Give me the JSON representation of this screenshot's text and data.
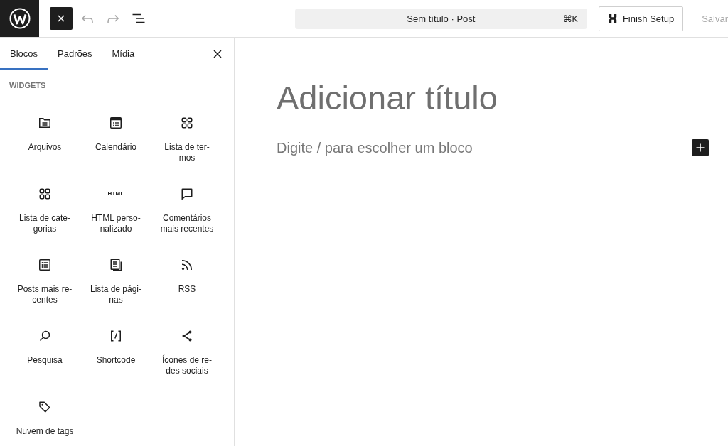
{
  "top_bar": {
    "undo": {
      "disabled": true
    },
    "redo": {
      "disabled": true
    },
    "command_bar": {
      "title": "Sem título · Post",
      "shortcut": "⌘K"
    },
    "finish_setup_button": {
      "label": "Finish Setup"
    },
    "save_button": {
      "label": "Salvar",
      "disabled": true
    }
  },
  "inserter": {
    "tabs": [
      {
        "label": "Blocos",
        "selected": true
      },
      {
        "label": "Padrões",
        "selected": false
      },
      {
        "label": "Mídia",
        "selected": false
      }
    ],
    "section_heading": "WIDGETS",
    "blocks": [
      {
        "label": "Arquivos",
        "kind": "archives"
      },
      {
        "label": "Calendário",
        "kind": "calendar"
      },
      {
        "label": "Lista de ter-\nmos",
        "kind": "terms"
      },
      {
        "label": "Lista de cate-\ngorias",
        "kind": "categories"
      },
      {
        "label": "HTML perso-\nnalizado",
        "kind": "html",
        "icon_text": "HTML"
      },
      {
        "label": "Comentários\nmais recentes",
        "kind": "comments"
      },
      {
        "label": "Posts mais re-\ncentes",
        "kind": "posts"
      },
      {
        "label": "Lista de pági-\nnas",
        "kind": "pages"
      },
      {
        "label": "RSS",
        "kind": "rss"
      },
      {
        "label": "Pesquisa",
        "kind": "search"
      },
      {
        "label": "Shortcode",
        "kind": "shortcode"
      },
      {
        "label": "Ícones de re-\ndes sociais",
        "kind": "social"
      },
      {
        "label": "Nuvem de tags",
        "kind": "tags"
      }
    ]
  },
  "editor": {
    "title": {
      "placeholder": "Adicionar título"
    },
    "paragraph": {
      "placeholder": "Digite / para escolher um bloco"
    }
  }
}
